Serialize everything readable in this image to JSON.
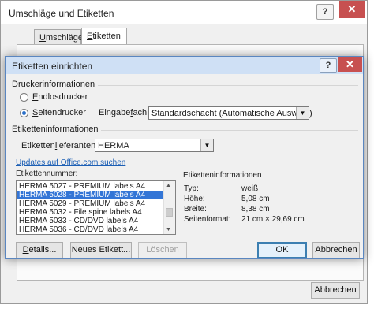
{
  "bg_dialog": {
    "title": "Umschläge und Etiketten",
    "help": "?",
    "close": "✕",
    "tabs": [
      {
        "pre": "",
        "key": "U",
        "post": "mschläge"
      },
      {
        "pre": "",
        "key": "E",
        "post": "tiketten"
      }
    ],
    "cancel_label": "Abbrechen"
  },
  "dialog": {
    "title": "Etiketten einrichten",
    "help": "?",
    "close": "✕",
    "printer_section": "Druckerinformationen",
    "continuous": {
      "key": "E",
      "post": "ndlosdrucker",
      "selected": false
    },
    "page": {
      "key": "S",
      "post": "eitendrucker",
      "selected": true
    },
    "feed_label": {
      "pre": "Eingabe",
      "key": "f",
      "post": "ach:"
    },
    "feed_value": "Standardschacht (Automatische Auswahl)",
    "label_section": "Etiketteninformationen",
    "vendor_label": {
      "pre": "Etiketten",
      "key": "l",
      "post": "ieferanten:"
    },
    "vendor_value": "HERMA",
    "updates_link": "Updates auf Office.com suchen",
    "number_label": {
      "pre": "Etiketten",
      "key": "n",
      "post": "ummer:"
    },
    "numbers": [
      "HERMA 5027 - PREMIUM labels A4",
      "HERMA 5028 - PREMIUM labels A4",
      "HERMA 5029 - PREMIUM labels A4",
      "HERMA 5032 - File spine labels A4",
      "HERMA 5033 - CD/DVD labels A4",
      "HERMA 5036 - CD/DVD labels A4"
    ],
    "selected_index": 1,
    "info_title": "Etiketteninformationen",
    "info": {
      "type_label": "Typ:",
      "type_value": "weiß",
      "height_label": "Höhe:",
      "height_value": "5,08 cm",
      "width_label": "Breite:",
      "width_value": "8,38 cm",
      "format_label": "Seitenformat:",
      "format_value": "21 cm × 29,69 cm"
    },
    "details_btn": {
      "key": "D",
      "post": "etails..."
    },
    "new_btn": {
      "pre": "Neues Etikett",
      "key": "",
      "post": "..."
    },
    "delete_btn": "Löschen",
    "ok_btn": "OK",
    "cancel_btn": "Abbrechen"
  }
}
